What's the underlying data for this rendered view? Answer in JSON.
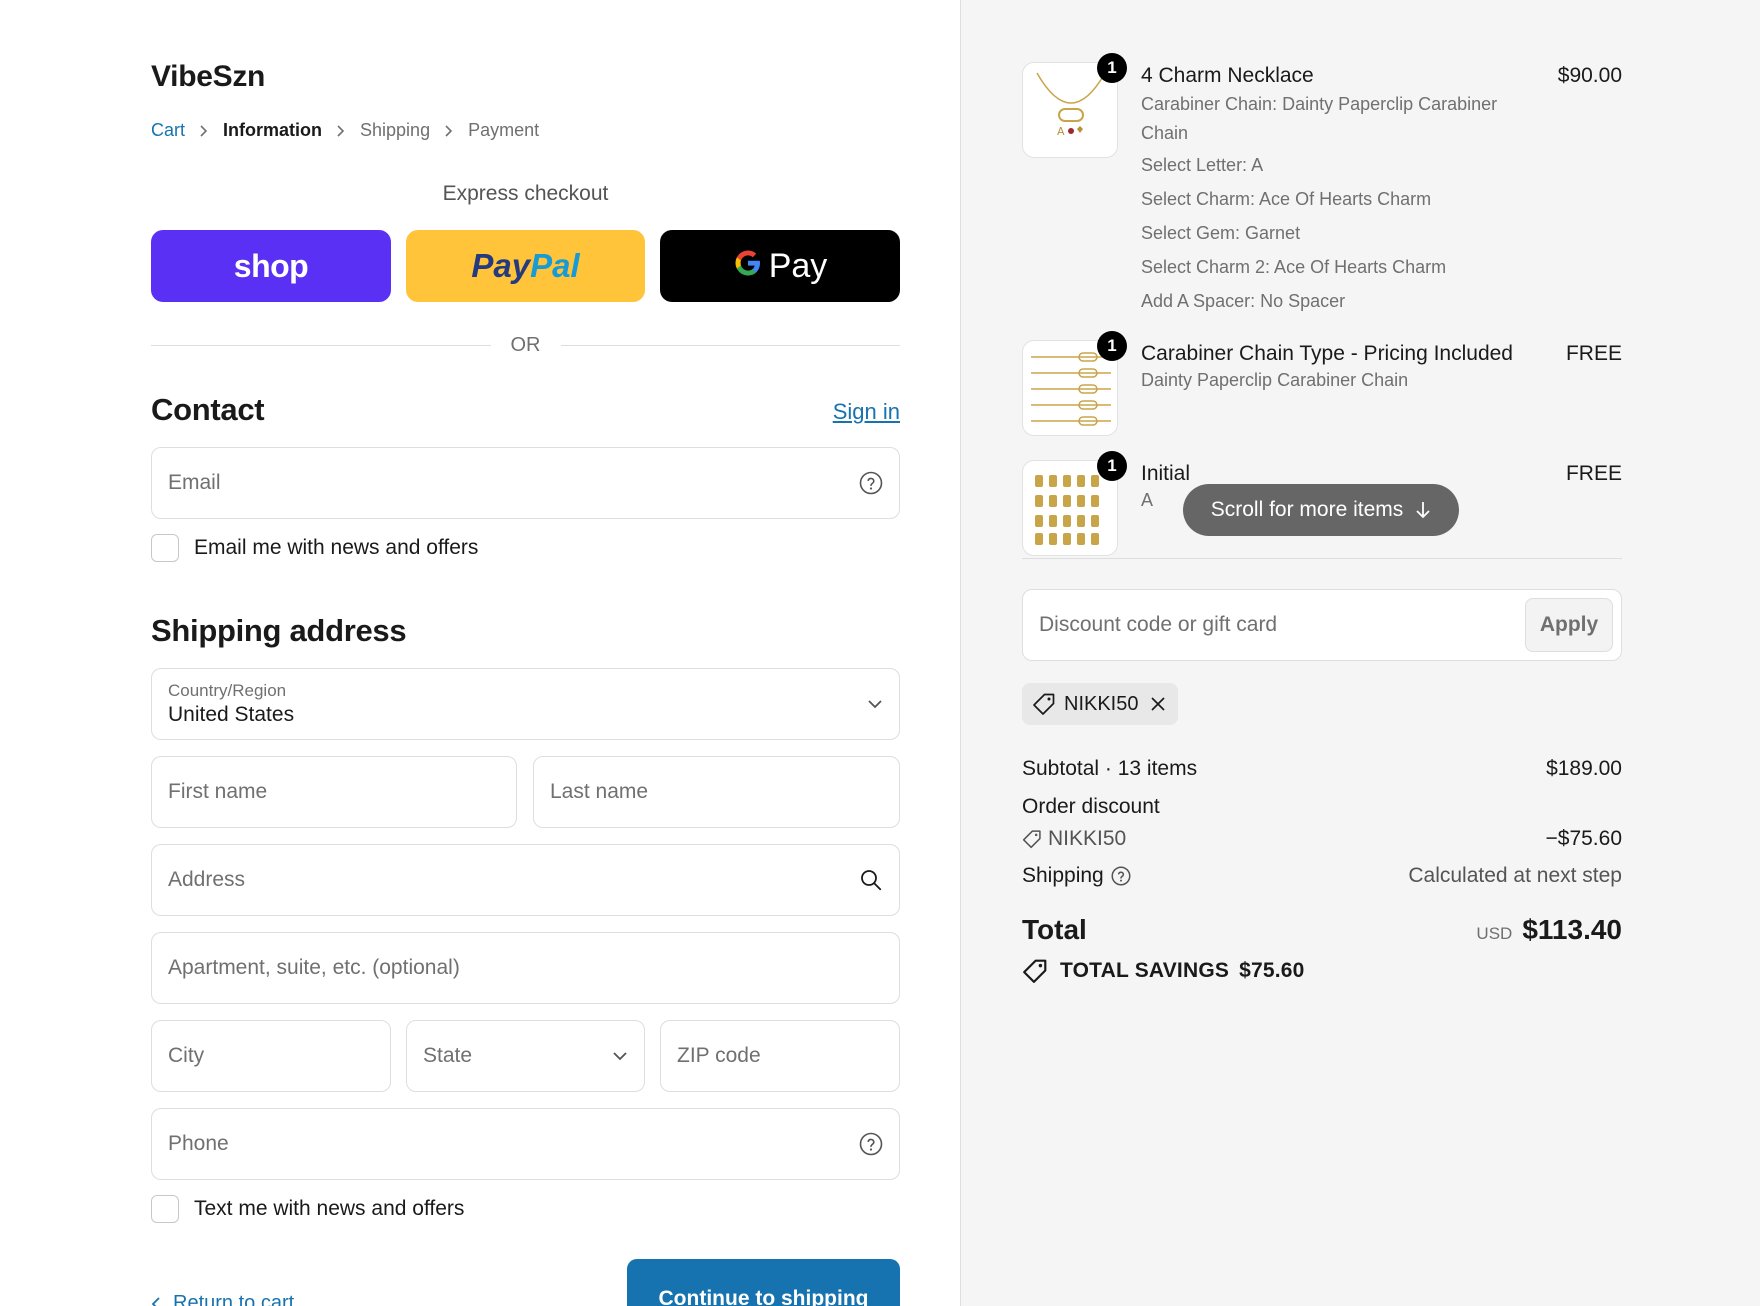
{
  "brand": "VibeSzn",
  "breadcrumb": {
    "cart": "Cart",
    "information": "Information",
    "shipping": "Shipping",
    "payment": "Payment"
  },
  "express": {
    "label": "Express checkout",
    "shop": "shop",
    "paypal_a": "Pay",
    "paypal_b": "Pal",
    "gpay_g": "G",
    "gpay": "Pay"
  },
  "or": "OR",
  "contact": {
    "heading": "Contact",
    "sign_in": "Sign in",
    "email_placeholder": "Email",
    "news_label": "Email me with news and offers"
  },
  "shipping": {
    "heading": "Shipping address",
    "country_label": "Country/Region",
    "country_value": "United States",
    "first_name": "First name",
    "last_name": "Last name",
    "address": "Address",
    "apartment": "Apartment, suite, etc. (optional)",
    "city": "City",
    "state": "State",
    "zip": "ZIP code",
    "phone": "Phone",
    "text_news": "Text me with news and offers"
  },
  "footer": {
    "return": "Return to cart",
    "continue": "Continue to shipping"
  },
  "order": {
    "items": [
      {
        "qty": "1",
        "title": "4 Charm Necklace",
        "price": "$90.00",
        "options": [
          "Carabiner Chain: Dainty Paperclip Carabiner Chain",
          "Select Letter: A",
          "Select Charm: Ace Of Hearts Charm",
          "Select Gem: Garnet",
          "Select Charm 2: Ace Of Hearts Charm",
          "Add A Spacer: No Spacer"
        ]
      },
      {
        "qty": "1",
        "title": "Carabiner Chain Type - Pricing Included",
        "sub": "Dainty Paperclip Carabiner Chain",
        "price": "FREE"
      },
      {
        "qty": "1",
        "title": "Initial",
        "sub": "A",
        "price": "FREE"
      }
    ],
    "scroll_hint": "Scroll for more items",
    "discount_placeholder": "Discount code or gift card",
    "apply": "Apply",
    "applied_code": "NIKKI50",
    "subtotal_label": "Subtotal · 13 items",
    "subtotal_value": "$189.00",
    "order_discount_label": "Order discount",
    "discount_code": "NIKKI50",
    "discount_value": "−$75.60",
    "shipping_label": "Shipping",
    "shipping_value": "Calculated at next step",
    "total_label": "Total",
    "currency": "USD",
    "total_value": "$113.40",
    "savings_label": "TOTAL SAVINGS",
    "savings_value": "$75.60"
  }
}
